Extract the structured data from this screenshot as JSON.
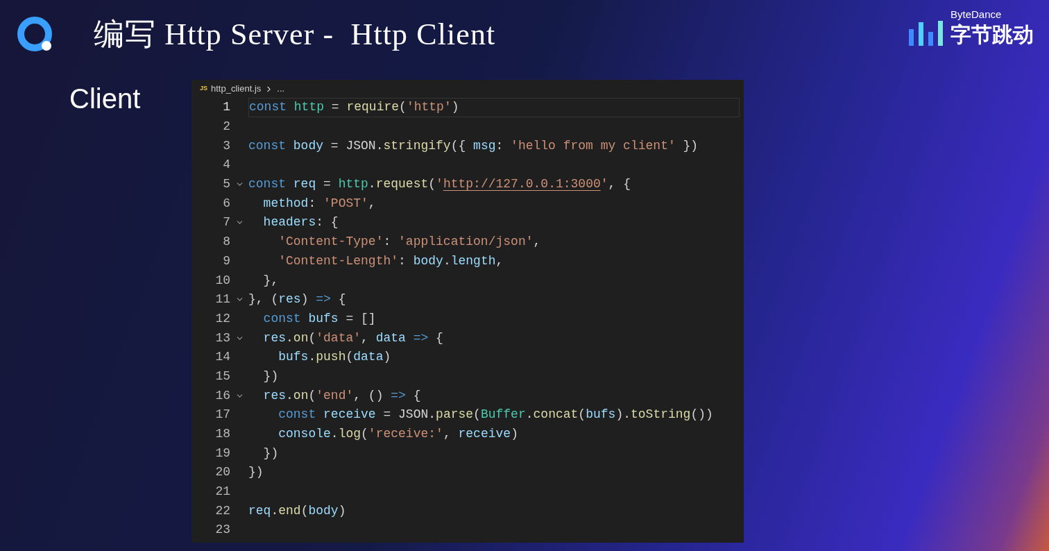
{
  "slide": {
    "title": "编写 Http Server -  Http Client",
    "brand": {
      "top": "ByteDance",
      "bottom": "字节跳动"
    },
    "label": "Client"
  },
  "editor": {
    "breadcrumb": {
      "file_icon": "JS",
      "file": "http_client.js",
      "rest": "..."
    },
    "lines": [
      {
        "number": "1",
        "foldable": false,
        "current": true,
        "tokens": [
          {
            "t": "const ",
            "kind": "keyword"
          },
          {
            "t": "http",
            "kind": "class"
          },
          {
            "t": " = "
          },
          {
            "t": "require",
            "kind": "function"
          },
          {
            "t": "("
          },
          {
            "t": "'http'",
            "kind": "string"
          },
          {
            "t": ")"
          }
        ]
      },
      {
        "number": "2",
        "foldable": false,
        "current": false
      },
      {
        "number": "3",
        "foldable": false,
        "current": false,
        "tokens": [
          {
            "t": "const ",
            "kind": "keyword"
          },
          {
            "t": "body",
            "kind": "variable"
          },
          {
            "t": " = JSON."
          },
          {
            "t": "stringify",
            "kind": "function"
          },
          {
            "t": "({ "
          },
          {
            "t": "msg",
            "kind": "variable"
          },
          {
            "t": ": "
          },
          {
            "t": "'hello from my client'",
            "kind": "string"
          },
          {
            "t": " })"
          }
        ]
      },
      {
        "number": "4",
        "foldable": false,
        "current": false
      },
      {
        "number": "5",
        "foldable": true,
        "current": false,
        "tokens": [
          {
            "t": "const ",
            "kind": "keyword"
          },
          {
            "t": "req",
            "kind": "variable"
          },
          {
            "t": " = "
          },
          {
            "t": "http",
            "kind": "class"
          },
          {
            "t": "."
          },
          {
            "t": "request",
            "kind": "function"
          },
          {
            "t": "("
          },
          {
            "t": "'",
            "kind": "string"
          },
          {
            "t": "http://127.0.0.1:3000",
            "kind": "link"
          },
          {
            "t": "'",
            "kind": "string"
          },
          {
            "t": ", {"
          }
        ]
      },
      {
        "number": "6",
        "foldable": false,
        "current": false,
        "tokens": [
          {
            "t": "  method",
            "kind": "variable"
          },
          {
            "t": ": "
          },
          {
            "t": "'POST'",
            "kind": "string"
          },
          {
            "t": ","
          }
        ]
      },
      {
        "number": "7",
        "foldable": true,
        "current": false,
        "tokens": [
          {
            "t": "  headers",
            "kind": "variable"
          },
          {
            "t": ": {"
          }
        ]
      },
      {
        "number": "8",
        "foldable": false,
        "current": false,
        "tokens": [
          {
            "t": "    'Content-Type'",
            "kind": "string"
          },
          {
            "t": ": "
          },
          {
            "t": "'application/json'",
            "kind": "string"
          },
          {
            "t": ","
          }
        ]
      },
      {
        "number": "9",
        "foldable": false,
        "current": false,
        "tokens": [
          {
            "t": "    'Content-Length'",
            "kind": "string"
          },
          {
            "t": ": "
          },
          {
            "t": "body",
            "kind": "variable"
          },
          {
            "t": "."
          },
          {
            "t": "length",
            "kind": "variable"
          },
          {
            "t": ","
          }
        ]
      },
      {
        "number": "10",
        "foldable": false,
        "current": false,
        "tokens": [
          {
            "t": "  },"
          }
        ]
      },
      {
        "number": "11",
        "foldable": true,
        "current": false,
        "tokens": [
          {
            "t": "}, ("
          },
          {
            "t": "res",
            "kind": "variable"
          },
          {
            "t": ") "
          },
          {
            "t": "=>",
            "kind": "keyword"
          },
          {
            "t": " {"
          }
        ]
      },
      {
        "number": "12",
        "foldable": false,
        "current": false,
        "tokens": [
          {
            "t": "  const ",
            "kind": "keyword"
          },
          {
            "t": "bufs",
            "kind": "variable"
          },
          {
            "t": " = []"
          }
        ]
      },
      {
        "number": "13",
        "foldable": true,
        "current": false,
        "tokens": [
          {
            "t": "  res",
            "kind": "variable"
          },
          {
            "t": "."
          },
          {
            "t": "on",
            "kind": "function"
          },
          {
            "t": "("
          },
          {
            "t": "'data'",
            "kind": "string"
          },
          {
            "t": ", "
          },
          {
            "t": "data ",
            "kind": "variable"
          },
          {
            "t": "=>",
            "kind": "keyword"
          },
          {
            "t": " {"
          }
        ]
      },
      {
        "number": "14",
        "foldable": false,
        "current": false,
        "tokens": [
          {
            "t": "    bufs",
            "kind": "variable"
          },
          {
            "t": "."
          },
          {
            "t": "push",
            "kind": "function"
          },
          {
            "t": "("
          },
          {
            "t": "data",
            "kind": "variable"
          },
          {
            "t": ")"
          }
        ]
      },
      {
        "number": "15",
        "foldable": false,
        "current": false,
        "tokens": [
          {
            "t": "  })"
          }
        ]
      },
      {
        "number": "16",
        "foldable": true,
        "current": false,
        "tokens": [
          {
            "t": "  res",
            "kind": "variable"
          },
          {
            "t": "."
          },
          {
            "t": "on",
            "kind": "function"
          },
          {
            "t": "("
          },
          {
            "t": "'end'",
            "kind": "string"
          },
          {
            "t": ", () "
          },
          {
            "t": "=>",
            "kind": "keyword"
          },
          {
            "t": " {"
          }
        ]
      },
      {
        "number": "17",
        "foldable": false,
        "current": false,
        "tokens": [
          {
            "t": "    const ",
            "kind": "keyword"
          },
          {
            "t": "receive",
            "kind": "variable"
          },
          {
            "t": " = JSON."
          },
          {
            "t": "parse",
            "kind": "function"
          },
          {
            "t": "("
          },
          {
            "t": "Buffer",
            "kind": "class"
          },
          {
            "t": "."
          },
          {
            "t": "concat",
            "kind": "function"
          },
          {
            "t": "("
          },
          {
            "t": "bufs",
            "kind": "variable"
          },
          {
            "t": ")."
          },
          {
            "t": "toString",
            "kind": "function"
          },
          {
            "t": "())"
          }
        ]
      },
      {
        "number": "18",
        "foldable": false,
        "current": false,
        "tokens": [
          {
            "t": "    console",
            "kind": "variable"
          },
          {
            "t": "."
          },
          {
            "t": "log",
            "kind": "function"
          },
          {
            "t": "("
          },
          {
            "t": "'receive:'",
            "kind": "string"
          },
          {
            "t": ", "
          },
          {
            "t": "receive",
            "kind": "variable"
          },
          {
            "t": ")"
          }
        ]
      },
      {
        "number": "19",
        "foldable": false,
        "current": false,
        "tokens": [
          {
            "t": "  })"
          }
        ]
      },
      {
        "number": "20",
        "foldable": false,
        "current": false,
        "tokens": [
          {
            "t": "})"
          }
        ]
      },
      {
        "number": "21",
        "foldable": false,
        "current": false
      },
      {
        "number": "22",
        "foldable": false,
        "current": false,
        "tokens": [
          {
            "t": "req",
            "kind": "variable"
          },
          {
            "t": "."
          },
          {
            "t": "end",
            "kind": "function"
          },
          {
            "t": "("
          },
          {
            "t": "body",
            "kind": "variable"
          },
          {
            "t": ")"
          }
        ]
      },
      {
        "number": "23",
        "foldable": false,
        "current": false
      }
    ]
  }
}
